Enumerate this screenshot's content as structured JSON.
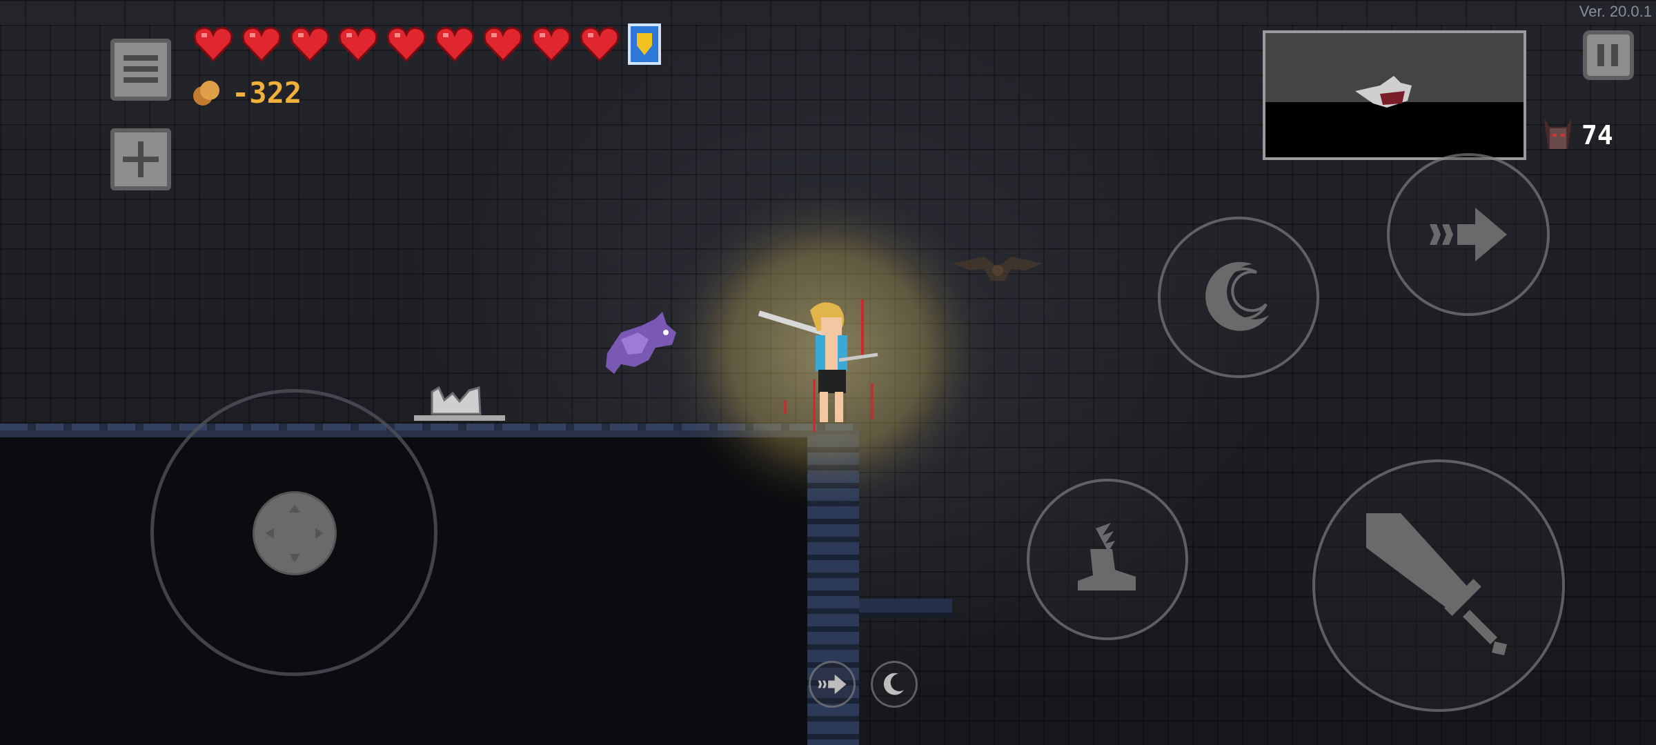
{
  "version": "Ver. 20.0.1",
  "hud": {
    "hearts_count": 9,
    "heart_color": "#e0262e",
    "gold": "-322",
    "gold_color": "#f0b13a",
    "enemies_remaining": "74"
  },
  "buttons": {
    "menu": "menu-icon",
    "inventory_add": "plus-icon",
    "pause": "pause-icon",
    "dash": "dash-arrow-icon",
    "skill_moon": "crescent-moon-icon",
    "jump": "winged-boot-icon",
    "attack": "sword-icon",
    "quick_dash": "dash-arrow-icon",
    "quick_moon": "crescent-moon-icon",
    "joystick": "joystick-icon"
  },
  "colors": {
    "background": "#1c1d22",
    "ground": "#283147",
    "glow": "#f6e18c",
    "ui_gray": "#8e8e8e"
  }
}
